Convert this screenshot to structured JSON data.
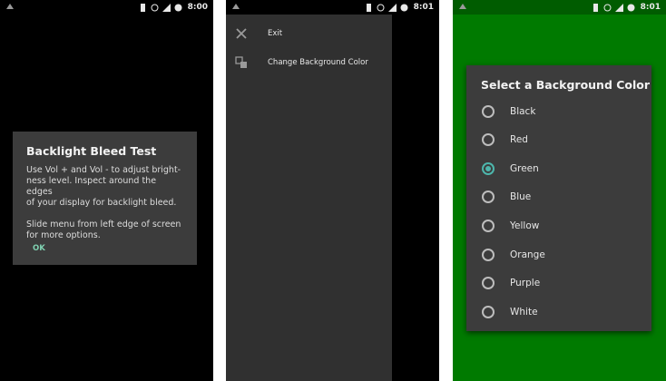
{
  "status": {
    "time1": "8:00",
    "time2": "8:01",
    "time3": "8:01"
  },
  "screen1": {
    "dialog": {
      "title": "Backlight Bleed Test",
      "message": "Use Vol + and Vol - to adjust bright-\nness level. Inspect around the edges\nof your display for backlight bleed.\n\nSlide menu from left edge of screen\nfor more options.",
      "ok": "OK"
    }
  },
  "screen2": {
    "drawer": {
      "items": [
        {
          "icon": "close-icon",
          "label": "Exit"
        },
        {
          "icon": "color-swatch-icon",
          "label": "Change Background Color"
        }
      ]
    }
  },
  "screen3": {
    "background": "#007a00",
    "dialog": {
      "title": "Select a Background Color",
      "selected": "Green",
      "options": [
        "Black",
        "Red",
        "Green",
        "Blue",
        "Yellow",
        "Orange",
        "Purple",
        "White"
      ]
    }
  },
  "colors": {
    "accent": "#4db6ac",
    "dialog_bg": "#3c3c3c",
    "drawer_bg": "#303030"
  }
}
